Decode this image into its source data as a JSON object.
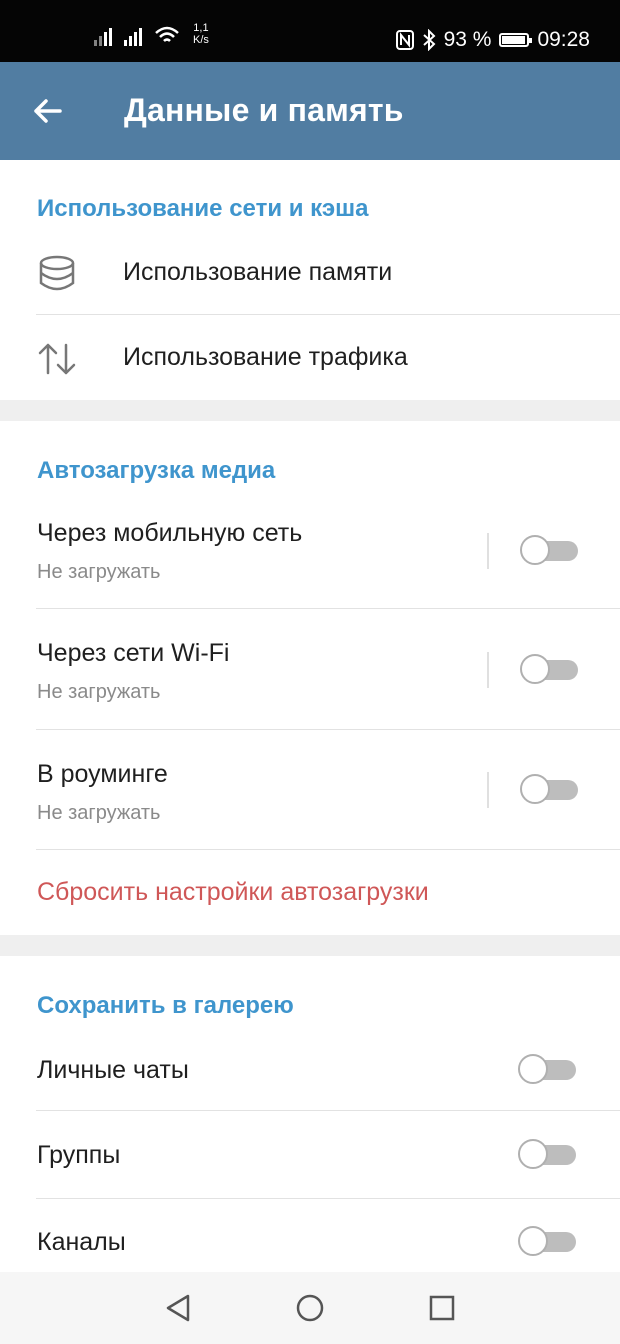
{
  "status_bar": {
    "speed_value": "1,1",
    "speed_unit": "K/s",
    "battery_percent": "93 %",
    "battery_level": 0.93,
    "time": "09:28",
    "icons": [
      "signal-icon",
      "signal-icon",
      "wifi-icon",
      "nfc-icon",
      "bluetooth-icon",
      "battery-icon"
    ]
  },
  "app_bar": {
    "title": "Данные и память",
    "back_icon": "arrow-left-icon",
    "color": "#517da2"
  },
  "network_section": {
    "header": "Использование сети и кэша",
    "items": [
      {
        "label": "Использование памяти",
        "icon": "database-icon"
      },
      {
        "label": "Использование трафика",
        "icon": "up-down-arrows-icon"
      }
    ]
  },
  "autodownload_section": {
    "header": "Автозагрузка медиа",
    "items": [
      {
        "label": "Через мобильную сеть",
        "subtitle": "Не загружать",
        "enabled": false
      },
      {
        "label": "Через сети Wi-Fi",
        "subtitle": "Не загружать",
        "enabled": false
      },
      {
        "label": "В роуминге",
        "subtitle": "Не загружать",
        "enabled": false
      }
    ],
    "reset_label": "Сбросить настройки автозагрузки",
    "reset_color": "#cf5757"
  },
  "gallery_section": {
    "header": "Сохранить в галерею",
    "items": [
      {
        "label": "Личные чаты",
        "enabled": false
      },
      {
        "label": "Группы",
        "enabled": false
      },
      {
        "label": "Каналы",
        "enabled": false
      }
    ]
  },
  "nav_bar": {
    "icons": [
      "back-triangle-icon",
      "home-circle-icon",
      "recents-square-icon"
    ]
  },
  "colors": {
    "header_blue": "#3f95cd",
    "toggle_off": "#bdbdbd"
  }
}
